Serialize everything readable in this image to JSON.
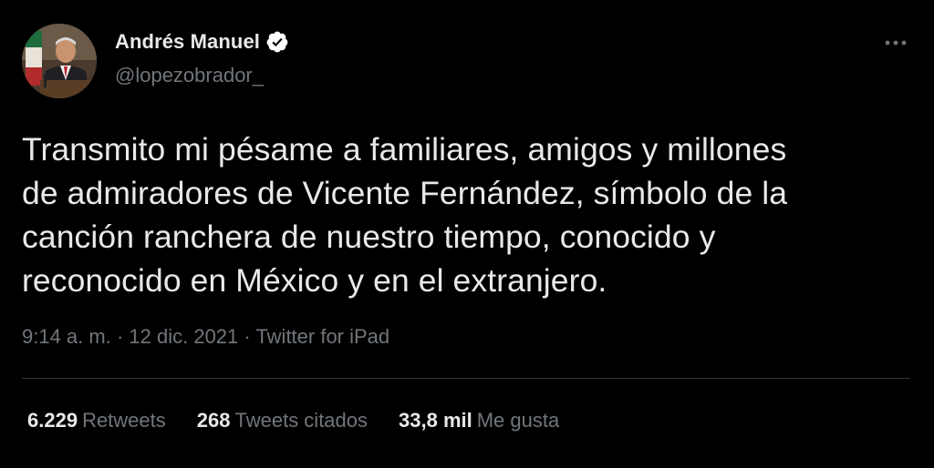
{
  "author": {
    "display_name": "Andrés Manuel",
    "handle": "@lopezobrador_",
    "verified": true,
    "verified_icon": "verified-badge-icon",
    "avatar": "avatar-photo"
  },
  "menu": {
    "icon": "more-options-icon"
  },
  "tweet": {
    "text": "Transmito mi pésame a familiares, amigos y millones\nde admiradores de Vicente Fernández, símbolo de la\ncanción ranchera de nuestro tiempo, conocido y\nreconocido en México y en el extranjero."
  },
  "meta": {
    "time": "9:14 a. m.",
    "sep1": " · ",
    "date": "12 dic. 2021",
    "sep2": " · ",
    "source": "Twitter for iPad"
  },
  "stats": {
    "retweets_count": "6.229",
    "retweets_label": "Retweets",
    "quotes_count": "268",
    "quotes_label": "Tweets citados",
    "likes_count": "33,8 mil",
    "likes_label": "Me gusta"
  },
  "colors": {
    "background": "#000000",
    "text_primary": "#e7e9ea",
    "text_secondary": "#71767b",
    "divider": "#2f3336",
    "verified_badge": "#ffffff"
  }
}
